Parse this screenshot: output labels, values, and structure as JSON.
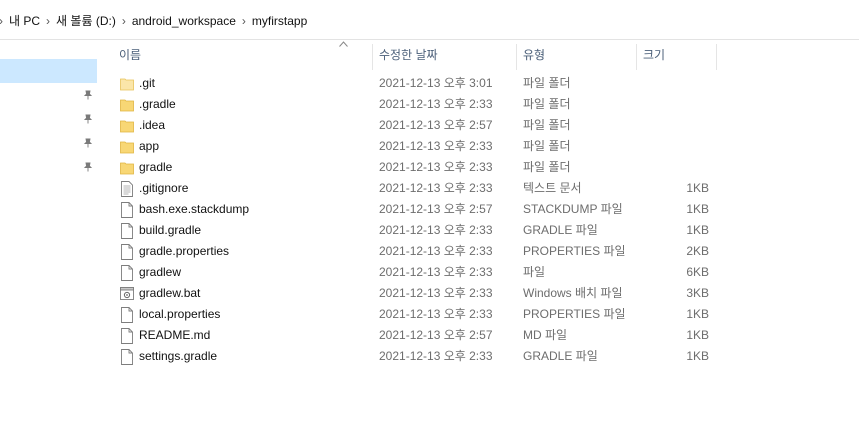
{
  "breadcrumb": {
    "items": [
      "내 PC",
      "새 볼륨 (D:)",
      "android_workspace",
      "myfirstapp"
    ],
    "separator": "›"
  },
  "columns": {
    "name": "이름",
    "date": "수정한 날짜",
    "type": "유형",
    "size": "크기"
  },
  "files": [
    {
      "name": ".git",
      "date": "2021-12-13 오후 3:01",
      "type": "파일 폴더",
      "size": "",
      "icon": "folder-icon"
    },
    {
      "name": ".gradle",
      "date": "2021-12-13 오후 2:33",
      "type": "파일 폴더",
      "size": "",
      "icon": "folder-icon"
    },
    {
      "name": ".idea",
      "date": "2021-12-13 오후 2:57",
      "type": "파일 폴더",
      "size": "",
      "icon": "folder-icon"
    },
    {
      "name": "app",
      "date": "2021-12-13 오후 2:33",
      "type": "파일 폴더",
      "size": "",
      "icon": "folder-icon"
    },
    {
      "name": "gradle",
      "date": "2021-12-13 오후 2:33",
      "type": "파일 폴더",
      "size": "",
      "icon": "folder-icon"
    },
    {
      "name": ".gitignore",
      "date": "2021-12-13 오후 2:33",
      "type": "텍스트 문서",
      "size": "1KB",
      "icon": "text-file-icon"
    },
    {
      "name": "bash.exe.stackdump",
      "date": "2021-12-13 오후 2:57",
      "type": "STACKDUMP 파일",
      "size": "1KB",
      "icon": "file-icon"
    },
    {
      "name": "build.gradle",
      "date": "2021-12-13 오후 2:33",
      "type": "GRADLE 파일",
      "size": "1KB",
      "icon": "file-icon"
    },
    {
      "name": "gradle.properties",
      "date": "2021-12-13 오후 2:33",
      "type": "PROPERTIES 파일",
      "size": "2KB",
      "icon": "file-icon"
    },
    {
      "name": "gradlew",
      "date": "2021-12-13 오후 2:33",
      "type": "파일",
      "size": "6KB",
      "icon": "file-icon"
    },
    {
      "name": "gradlew.bat",
      "date": "2021-12-13 오후 2:33",
      "type": "Windows 배치 파일",
      "size": "3KB",
      "icon": "batch-file-icon"
    },
    {
      "name": "local.properties",
      "date": "2021-12-13 오후 2:33",
      "type": "PROPERTIES 파일",
      "size": "1KB",
      "icon": "file-icon"
    },
    {
      "name": "README.md",
      "date": "2021-12-13 오후 2:57",
      "type": "MD 파일",
      "size": "1KB",
      "icon": "file-icon"
    },
    {
      "name": "settings.gradle",
      "date": "2021-12-13 오후 2:33",
      "type": "GRADLE 파일",
      "size": "1KB",
      "icon": "file-icon"
    }
  ],
  "colors": {
    "folder": "#f8d775",
    "selection": "#cce8ff",
    "header_text": "#4c607a"
  }
}
